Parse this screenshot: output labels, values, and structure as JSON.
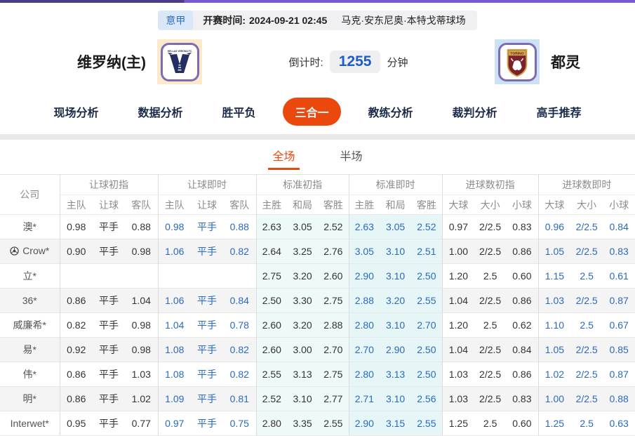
{
  "colors": {
    "accent_orange": "#ea480c",
    "live_blue": "#2a69c0",
    "countdown_blue": "#1d5ec6",
    "std_initial_bg": "#eef9f9",
    "std_live_bg": "#e6f6f6",
    "topbar_purple_dark": "#4c3c87",
    "topbar_purple_light": "#7a5ad2",
    "home_logo_bg": "#fbe9cc",
    "away_logo_bg": "#cde1f6"
  },
  "top_info": {
    "league": "意甲",
    "kickoff_label": "开赛时间:",
    "kickoff_time": "2024-09-21 02:45",
    "venue": "马克·安东尼奥·本特戈蒂球场"
  },
  "match": {
    "home_team": "维罗纳(主)",
    "away_team": "都灵",
    "home_crest": "hellas-verona-crest",
    "away_crest": "torino-crest",
    "countdown_label": "倒计时:",
    "countdown_value": "1255",
    "countdown_unit": "分钟"
  },
  "nav": {
    "tabs": [
      {
        "label": "现场分析",
        "active": false
      },
      {
        "label": "数据分析",
        "active": false
      },
      {
        "label": "胜平负",
        "active": false
      },
      {
        "label": "三合一",
        "active": true
      },
      {
        "label": "教练分析",
        "active": false
      },
      {
        "label": "裁判分析",
        "active": false
      },
      {
        "label": "高手推荐",
        "active": false
      }
    ]
  },
  "subtabs": [
    {
      "label": "全场",
      "active": true
    },
    {
      "label": "半场",
      "active": false
    }
  ],
  "table": {
    "company_header": "公司",
    "groups": [
      {
        "key": "handicap_initial",
        "label": "让球初指",
        "cols": [
          "主队",
          "让球",
          "客队"
        ],
        "live": false,
        "cyan": false
      },
      {
        "key": "handicap_live",
        "label": "让球即时",
        "cols": [
          "主队",
          "让球",
          "客队"
        ],
        "live": true,
        "cyan": false
      },
      {
        "key": "std_initial",
        "label": "标准初指",
        "cols": [
          "主胜",
          "和局",
          "客胜"
        ],
        "live": false,
        "cyan": "a"
      },
      {
        "key": "std_live",
        "label": "标准即时",
        "cols": [
          "主胜",
          "和局",
          "客胜"
        ],
        "live": true,
        "cyan": "b"
      },
      {
        "key": "goals_initial",
        "label": "进球数初指",
        "cols": [
          "大球",
          "大小",
          "小球"
        ],
        "live": false,
        "cyan": false
      },
      {
        "key": "goals_live",
        "label": "进球数即时",
        "cols": [
          "大球",
          "大小",
          "小球"
        ],
        "live": true,
        "cyan": false
      }
    ],
    "rows": [
      {
        "company": "澳*",
        "icon": null,
        "handicap_initial": [
          "0.98",
          "平手",
          "0.88"
        ],
        "handicap_live": [
          "0.98",
          "平手",
          "0.88"
        ],
        "std_initial": [
          "2.63",
          "3.05",
          "2.52"
        ],
        "std_live": [
          "2.63",
          "3.05",
          "2.52"
        ],
        "goals_initial": [
          "0.97",
          "2/2.5",
          "0.83"
        ],
        "goals_live": [
          "0.96",
          "2/2.5",
          "0.84"
        ]
      },
      {
        "company": "Crow*",
        "icon": "soccer-ball",
        "handicap_initial": [
          "0.90",
          "平手",
          "0.98"
        ],
        "handicap_live": [
          "1.06",
          "平手",
          "0.82"
        ],
        "std_initial": [
          "2.64",
          "3.25",
          "2.76"
        ],
        "std_live": [
          "3.05",
          "3.10",
          "2.51"
        ],
        "goals_initial": [
          "1.00",
          "2/2.5",
          "0.86"
        ],
        "goals_live": [
          "1.05",
          "2/2.5",
          "0.83"
        ]
      },
      {
        "company": "立*",
        "icon": null,
        "handicap_initial": [
          "",
          "",
          ""
        ],
        "handicap_live": [
          "",
          "",
          ""
        ],
        "std_initial": [
          "2.75",
          "3.20",
          "2.60"
        ],
        "std_live": [
          "2.90",
          "3.10",
          "2.50"
        ],
        "goals_initial": [
          "1.20",
          "2.5",
          "0.60"
        ],
        "goals_live": [
          "1.15",
          "2.5",
          "0.61"
        ]
      },
      {
        "company": "36*",
        "icon": null,
        "handicap_initial": [
          "0.86",
          "平手",
          "1.04"
        ],
        "handicap_live": [
          "1.06",
          "平手",
          "0.84"
        ],
        "std_initial": [
          "2.50",
          "3.30",
          "2.75"
        ],
        "std_live": [
          "2.88",
          "3.20",
          "2.55"
        ],
        "goals_initial": [
          "1.04",
          "2/2.5",
          "0.86"
        ],
        "goals_live": [
          "1.03",
          "2/2.5",
          "0.87"
        ]
      },
      {
        "company": "威廉希*",
        "icon": null,
        "handicap_initial": [
          "0.82",
          "平手",
          "0.98"
        ],
        "handicap_live": [
          "1.04",
          "平手",
          "0.78"
        ],
        "std_initial": [
          "2.60",
          "3.20",
          "2.88"
        ],
        "std_live": [
          "2.80",
          "3.10",
          "2.70"
        ],
        "goals_initial": [
          "1.20",
          "2.5",
          "0.62"
        ],
        "goals_live": [
          "1.10",
          "2.5",
          "0.67"
        ]
      },
      {
        "company": "易*",
        "icon": null,
        "handicap_initial": [
          "0.92",
          "平手",
          "0.98"
        ],
        "handicap_live": [
          "1.08",
          "平手",
          "0.82"
        ],
        "std_initial": [
          "2.60",
          "3.00",
          "2.70"
        ],
        "std_live": [
          "2.70",
          "2.90",
          "2.50"
        ],
        "goals_initial": [
          "1.04",
          "2/2.5",
          "0.84"
        ],
        "goals_live": [
          "1.05",
          "2/2.5",
          "0.85"
        ]
      },
      {
        "company": "伟*",
        "icon": null,
        "handicap_initial": [
          "0.86",
          "平手",
          "1.03"
        ],
        "handicap_live": [
          "1.08",
          "平手",
          "0.82"
        ],
        "std_initial": [
          "2.55",
          "3.13",
          "2.75"
        ],
        "std_live": [
          "2.80",
          "3.13",
          "2.50"
        ],
        "goals_initial": [
          "1.03",
          "2/2.5",
          "0.86"
        ],
        "goals_live": [
          "1.02",
          "2/2.5",
          "0.87"
        ]
      },
      {
        "company": "明*",
        "icon": null,
        "handicap_initial": [
          "0.86",
          "平手",
          "1.02"
        ],
        "handicap_live": [
          "1.09",
          "平手",
          "0.81"
        ],
        "std_initial": [
          "2.52",
          "3.10",
          "2.77"
        ],
        "std_live": [
          "2.71",
          "3.10",
          "2.56"
        ],
        "goals_initial": [
          "1.03",
          "2/2.5",
          "0.83"
        ],
        "goals_live": [
          "1.00",
          "2/2.5",
          "0.88"
        ]
      },
      {
        "company": "Interwet*",
        "icon": null,
        "handicap_initial": [
          "0.95",
          "平手",
          "0.77"
        ],
        "handicap_live": [
          "0.97",
          "平手",
          "0.75"
        ],
        "std_initial": [
          "2.80",
          "3.35",
          "2.55"
        ],
        "std_live": [
          "2.90",
          "3.15",
          "2.55"
        ],
        "goals_initial": [
          "1.25",
          "2.5",
          "0.60"
        ],
        "goals_live": [
          "1.25",
          "2.5",
          "0.63"
        ]
      }
    ]
  }
}
